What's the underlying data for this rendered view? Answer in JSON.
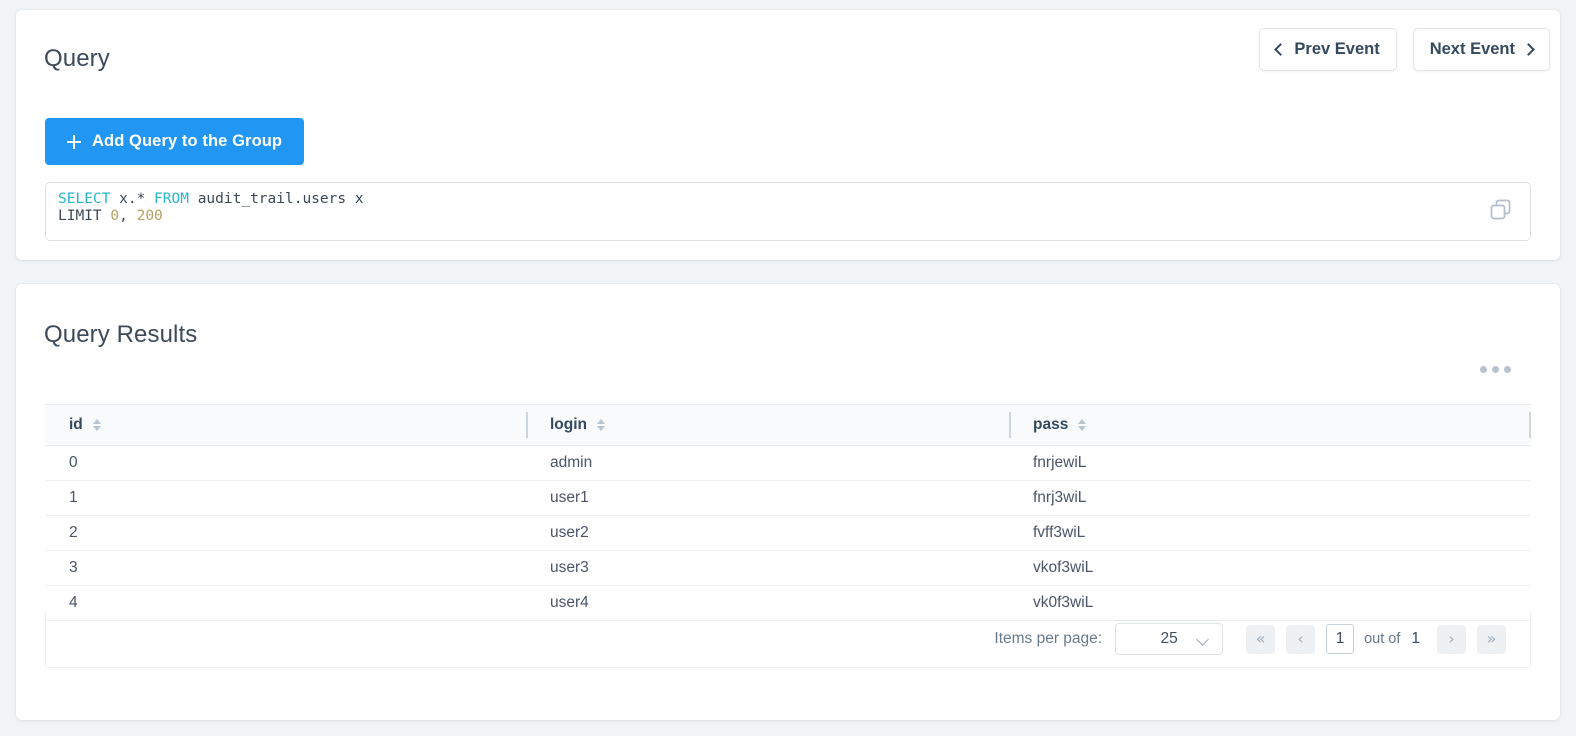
{
  "query_card": {
    "title": "Query",
    "nav": {
      "prev_label": "Prev Event",
      "next_label": "Next Event"
    },
    "add_query_label": "Add Query to the Group",
    "sql": {
      "line1": {
        "select_kw": "SELECT",
        "select_expr": " x.* ",
        "from_kw": "FROM",
        "table": " audit_trail.users x"
      },
      "line2": {
        "limit_kw": "LIMIT",
        "offset": "0",
        "comma": ", ",
        "count": "200"
      },
      "full_text": "SELECT x.* FROM audit_trail.users x\nLIMIT 0, 200"
    },
    "copy_icon": "copy-icon"
  },
  "results_card": {
    "title": "Query Results",
    "menu_icon": "more-options-icon",
    "table": {
      "columns": [
        {
          "key": "id",
          "label": "id"
        },
        {
          "key": "login",
          "label": "login"
        },
        {
          "key": "pass",
          "label": "pass"
        }
      ],
      "rows": [
        {
          "id": "0",
          "login": "admin",
          "pass": "fnrjewiL"
        },
        {
          "id": "1",
          "login": "user1",
          "pass": "fnrj3wiL"
        },
        {
          "id": "2",
          "login": "user2",
          "pass": "fvff3wiL"
        },
        {
          "id": "3",
          "login": "user3",
          "pass": "vkof3wiL"
        },
        {
          "id": "4",
          "login": "user4",
          "pass": "vk0f3wiL"
        }
      ]
    },
    "paginator": {
      "items_per_page_label": "Items per page:",
      "items_per_page_value": "25",
      "items_per_page_options": [
        "25"
      ],
      "first_page_label": "«",
      "prev_page_label": "‹",
      "current_page": "1",
      "out_of_label": "out of",
      "total_pages": "1",
      "next_page_label": "›",
      "last_page_label": "»"
    }
  },
  "colors": {
    "page_background": "#f1f4f6",
    "card_background": "#ffffff",
    "accent_blue": "#2196f3",
    "heading_text": "#3c4a5a",
    "sql_keyword": "#29b6c8",
    "sql_number": "#b5a162"
  }
}
